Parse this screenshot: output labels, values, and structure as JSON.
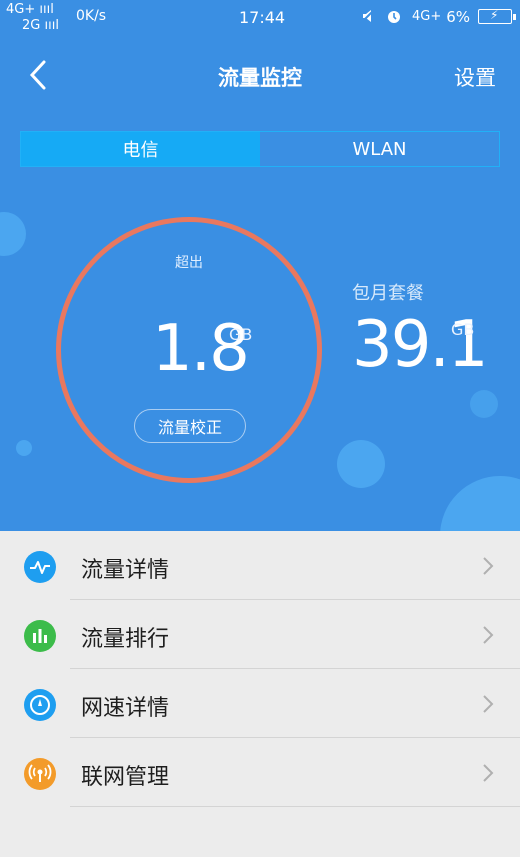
{
  "status_bar": {
    "net_top": "4G+ ıııl",
    "net_bottom": "2G ıııl",
    "speed": "0K/s",
    "time": "17:44",
    "net_right": "4G+",
    "battery_pct": "6%"
  },
  "nav": {
    "title": "流量监控",
    "settings_label": "设置"
  },
  "tabs": [
    {
      "label": "电信",
      "active": true
    },
    {
      "label": "WLAN",
      "active": false
    }
  ],
  "usage": {
    "status_label": "超出",
    "value": "1.8",
    "unit": "GB",
    "calibrate_label": "流量校正"
  },
  "plan": {
    "label": "包月套餐",
    "value": "39.1",
    "unit": "GB"
  },
  "menu": [
    {
      "label": "流量详情",
      "icon": "pulse-icon",
      "color": "#1e9ef0"
    },
    {
      "label": "流量排行",
      "icon": "bar-chart-icon",
      "color": "#3cbc4a"
    },
    {
      "label": "网速详情",
      "icon": "speed-gauge-icon",
      "color": "#1e9ef0"
    },
    {
      "label": "联网管理",
      "icon": "broadcast-icon",
      "color": "#f39b2a"
    }
  ],
  "colors": {
    "header_blue": "#3a8fe3",
    "tab_active": "#16aaf5",
    "ring": "#e9785f"
  }
}
